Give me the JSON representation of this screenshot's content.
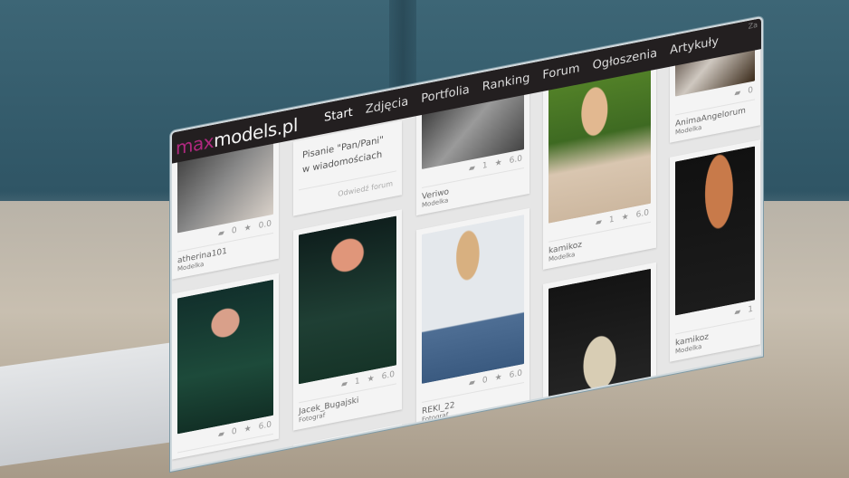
{
  "nav": {
    "logo_prefix": "ma",
    "logo_x": "x",
    "logo_rest": "models.pl",
    "items": [
      "Start",
      "Zdjęcia",
      "Portfolia",
      "Ranking",
      "Forum",
      "Ogłoszenia",
      "Artykuły"
    ],
    "top_right": "Za"
  },
  "columns": [
    {
      "cards": [
        {
          "name": "atherina101",
          "role": "Modelka",
          "comments": "0",
          "rating": "0.0"
        },
        {
          "name": "",
          "role": "",
          "comments": "0",
          "rating": "6.0"
        }
      ]
    },
    {
      "forum": {
        "title": "Pisanie \"Pan/Pani\" w wiadomościach",
        "link": "Odwiedź forum"
      },
      "cards": [
        {
          "name": "Jacek_Bugajski",
          "role": "Fotograf",
          "comments": "1",
          "rating": "6.0"
        }
      ]
    },
    {
      "cards": [
        {
          "name": "Veriwo",
          "role": "Modelka",
          "comments": "1",
          "rating": "6.0"
        },
        {
          "name": "REKI_22",
          "role": "Fotograf",
          "comments": "0",
          "rating": "6.0"
        }
      ]
    },
    {
      "cards": [
        {
          "name": "kamikoz",
          "role": "Modelka",
          "comments": "1",
          "rating": "6.0"
        }
      ]
    },
    {
      "cards": [
        {
          "name": "AnimaAngelorum",
          "role": "Modelka",
          "comments": "0",
          "rating": ""
        },
        {
          "name": "kamikoz",
          "role": "Modelka",
          "comments": "1",
          "rating": ""
        }
      ]
    }
  ],
  "colors": {
    "nav_bg": "#231f20",
    "logo_accent": "#b0287f"
  }
}
